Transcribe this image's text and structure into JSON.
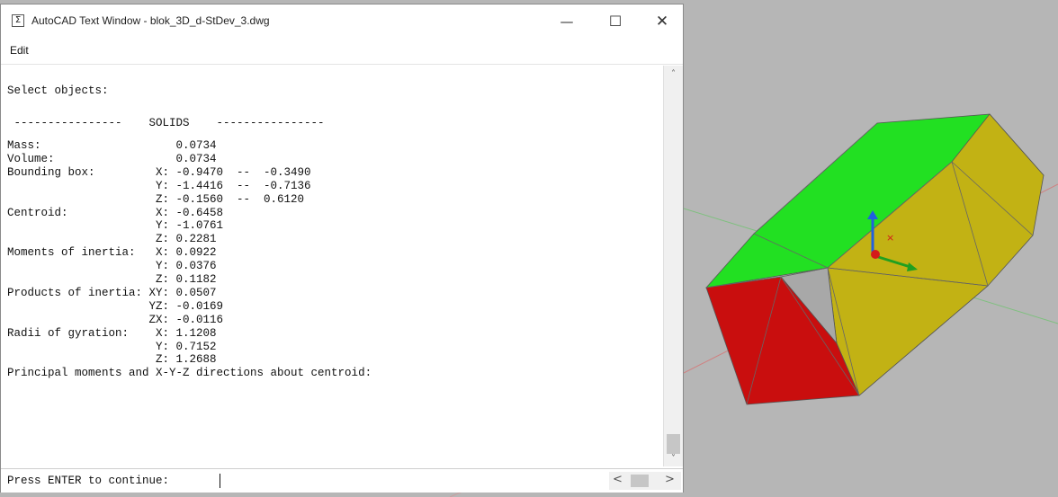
{
  "window": {
    "title": "AutoCAD Text Window - blok_3D_d-StDev_3.dwg",
    "icon_glyph": "Σ",
    "minimize_glyph": "—",
    "maximize_glyph": "☐",
    "close_glyph": "✕"
  },
  "menu": {
    "edit": "Edit"
  },
  "output_lines": [
    "Select objects:",
    "",
    " ----------------    SOLIDS    ----------------",
    "",
    "Mass:                    0.0734",
    "Volume:                  0.0734",
    "Bounding box:         X: -0.9470  --  -0.3490",
    "                      Y: -1.4416  --  -0.7136",
    "                      Z: -0.1560  --  0.6120",
    "Centroid:             X: -0.6458",
    "                      Y: -1.0761",
    "                      Z: 0.2281",
    "Moments of inertia:   X: 0.0922",
    "                      Y: 0.0376",
    "                      Z: 0.1182",
    "Products of inertia: XY: 0.0507",
    "                     YZ: -0.0169",
    "                     ZX: -0.0116",
    "Radii of gyration:    X: 1.1208",
    "                      Y: 0.7152",
    "                      Z: 1.2688",
    "Principal moments and X-Y-Z directions about centroid:"
  ],
  "command_prompt": "Press ENTER to continue:",
  "scroll": {
    "up": "˄",
    "down": "˅",
    "left": "<",
    "right": ">"
  },
  "colors": {
    "top_face": "#22e022",
    "side_face": "#c2b214",
    "front_face": "#c90e0e",
    "inner_face": "#a8a8a8",
    "viewport": "#b6b6b6"
  }
}
